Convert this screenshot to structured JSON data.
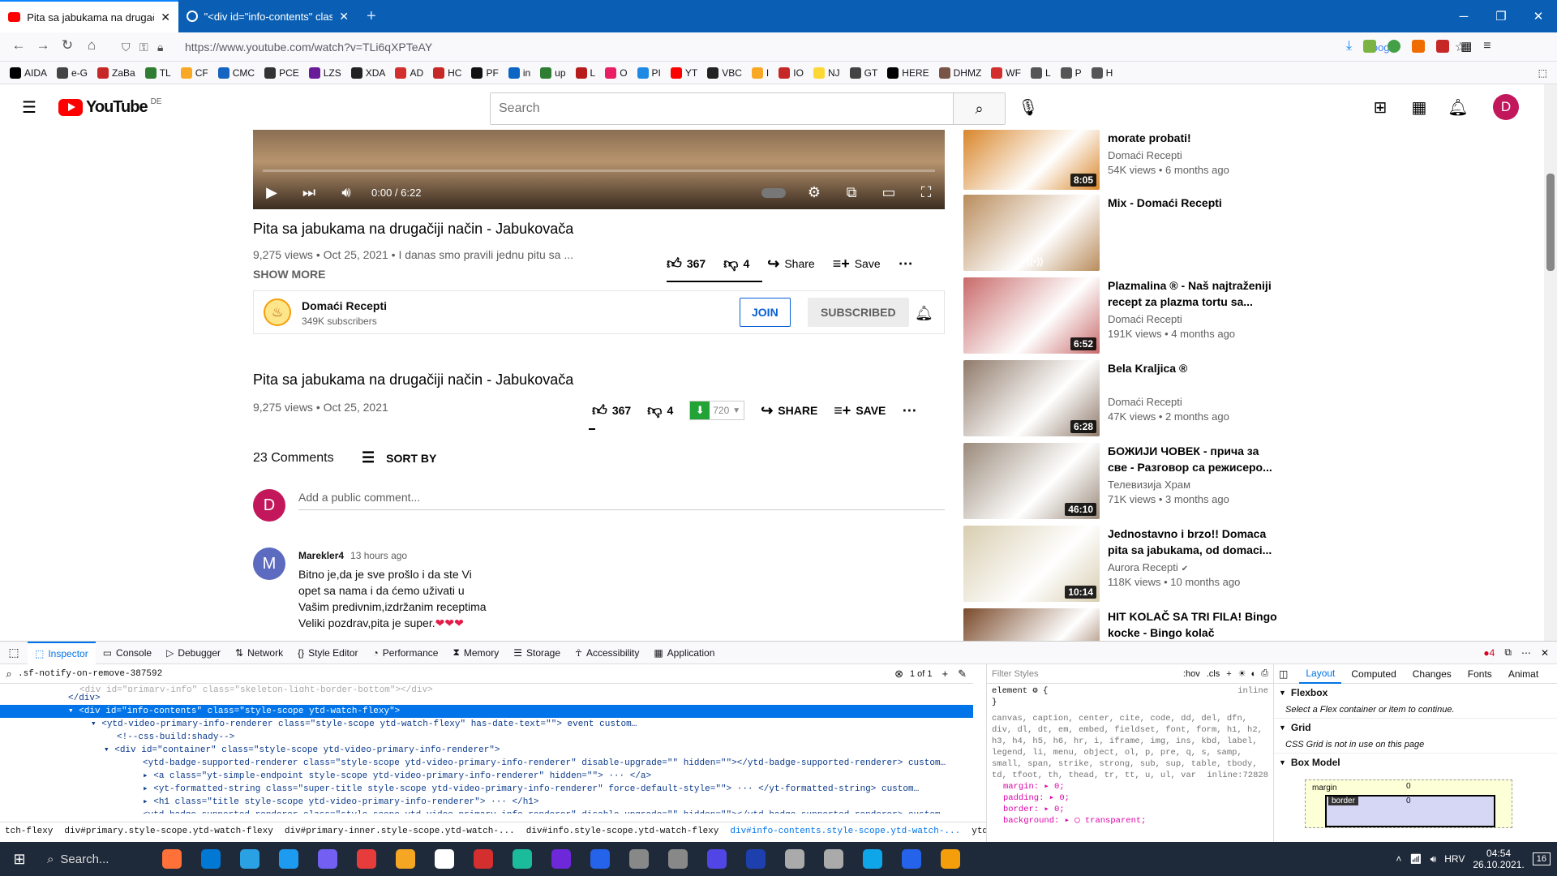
{
  "browser": {
    "tabs": [
      {
        "title": "Pita sa jabukama na drugačiji na",
        "active": true
      },
      {
        "title": "\"<div id=\"info-contents\" class=",
        "active": false
      }
    ],
    "new_tab": "+",
    "window_controls": {
      "minimize": "─",
      "restore": "❐",
      "close": "✕"
    },
    "url": "https://www.youtube.com/watch?v=TLi6qXPTeAY",
    "google_label": "Google",
    "bookmarks": [
      "AIDA",
      "e-G",
      "ZaBa",
      "TL",
      "CF",
      "CMC",
      "PCE",
      "LZS",
      "XDA",
      "AD",
      "HC",
      "PF",
      "in",
      "up",
      "L",
      "O",
      "PI",
      "YT",
      "VBC",
      "I",
      "IO",
      "NJ",
      "GT",
      "HERE",
      "DHMZ",
      "WF",
      "L",
      "P",
      "H"
    ],
    "bookmark_colors": [
      "#000",
      "#444",
      "#c62828",
      "#2e7d32",
      "#f9a825",
      "#1565c0",
      "#333",
      "#6a1b9a",
      "#222",
      "#d32f2f",
      "#c62828",
      "#111",
      "#0a66c2",
      "#2e7d32",
      "#b71c1c",
      "#e91e63",
      "#1e88e5",
      "#f00",
      "#222",
      "#f9a825",
      "#c62828",
      "#fdd835",
      "#444",
      "#000",
      "#795548",
      "#d32f2f",
      "#555",
      "#555",
      "#555"
    ]
  },
  "youtube": {
    "logo_text": "YouTube",
    "country": "DE",
    "search_placeholder": "Search",
    "avatar_letter": "D",
    "player": {
      "time": "0:00 / 6:22"
    },
    "video1": {
      "title": "Pita sa jabukama na drugačiji način - Jabukovača",
      "meta": "9,275 views • Oct 25, 2021 • I danas smo pravili jednu pitu sa ...",
      "show_more": "SHOW MORE",
      "likes": "367",
      "dislikes": "4",
      "share": "Share",
      "save": "Save"
    },
    "channel": {
      "name": "Domaći Recepti",
      "subscribers": "349K subscribers",
      "join": "JOIN",
      "subscribed": "SUBSCRIBED"
    },
    "video2": {
      "title": "Pita sa jabukama na drugačiji način - Jabukovača",
      "meta": "9,275 views • Oct 25, 2021",
      "likes": "367",
      "dislikes": "4",
      "download_quality": "720",
      "share": "SHARE",
      "save": "SAVE"
    },
    "comments": {
      "count": "23 Comments",
      "sort": "SORT BY",
      "add_placeholder": "Add a public comment...",
      "user_letter": "D",
      "items": [
        {
          "author": "Marekler4",
          "time": "13 hours ago",
          "avatar": "M",
          "lines": [
            "Bitno je,da je sve prošlo i da ste Vi",
            "opet sa nama i da ćemo uživati u",
            "Vašim predivnim,izdržanim receptima",
            "Veliki pozdrav,pita je super."
          ],
          "hearts": "❤❤❤"
        }
      ]
    },
    "recommended": [
      {
        "title": "morate probati!",
        "channel": "Domaći Recepti",
        "stats": "54K views • 6 months ago",
        "duration": "8:05",
        "color": "#d9862b"
      },
      {
        "title": "Mix - Domaći Recepti",
        "channel": "",
        "stats": "",
        "duration": "((•))",
        "color": "#b98c5c"
      },
      {
        "title": "Plazmalina ® - Naš najtraženiji recept za plazma tortu sa...",
        "channel": "Domaći Recepti",
        "stats": "191K views • 4 months ago",
        "duration": "6:52",
        "color": "#c96a6a"
      },
      {
        "title": "Bela Kraljica ®",
        "channel": "Domaći Recepti",
        "stats": "47K views • 2 months ago",
        "duration": "6:28",
        "color": "#8f7a6a"
      },
      {
        "title": "БОЖИЈИ ЧОВЕК - прича за све - Разговор са режисеро...",
        "channel": "Телевизија Храм",
        "stats": "71K views • 3 months ago",
        "duration": "46:10",
        "color": "#9a8a7a"
      },
      {
        "title": "Jednostavno i brzo!! Domaca pita sa jabukama, od domaci...",
        "channel": "Aurora Recepti",
        "stats": "118K views • 10 months ago",
        "duration": "10:14",
        "color": "#d8cdb0",
        "verified": "✔"
      },
      {
        "title": "HIT KOLAČ SA TRI FILA! Bingo kocke - Bingo kolač",
        "channel": "",
        "stats": "",
        "duration": "",
        "color": "#7a4a2a"
      }
    ]
  },
  "devtools": {
    "tabs": [
      "Inspector",
      "Console",
      "Debugger",
      "Network",
      "Style Editor",
      "Performance",
      "Memory",
      "Storage",
      "Accessibility",
      "Application"
    ],
    "error_count": "4",
    "search_value": ".sf-notify-on-remove-387592",
    "search_count": "1 of 1",
    "filter_placeholder": "Filter Styles",
    "hov": ":hov",
    "cls": ".cls",
    "right_tabs": [
      "Layout",
      "Computed",
      "Changes",
      "Fonts",
      "Animat"
    ],
    "html_lines": [
      "<div id=\"primary-info\" class=\"skeleton-light-border-bottom\"></div>",
      "</div>",
      "▾ <div id=\"info-contents\" class=\"style-scope ytd-watch-flexy\">",
      "▾ <ytd-video-primary-info-renderer class=\"style-scope ytd-watch-flexy\" has-date-text=\"\">  event  custom…",
      "<!--css-build:shady-->",
      "▾ <div id=\"container\" class=\"style-scope ytd-video-primary-info-renderer\">",
      "<ytd-badge-supported-renderer class=\"style-scope ytd-video-primary-info-renderer\" disable-upgrade=\"\" hidden=\"\"></ytd-badge-supported-renderer>  custom…",
      "▸ <a class=\"yt-simple-endpoint style-scope ytd-video-primary-info-renderer\" hidden=\"\"> ··· </a>",
      "▸ <yt-formatted-string class=\"super-title style-scope ytd-video-primary-info-renderer\" force-default-style=\"\"> ··· </yt-formatted-string>  custom…",
      "▸ <h1 class=\"title style-scope ytd-video-primary-info-renderer\"> ··· </h1>",
      "<ytd-badge-supported-renderer class=\"style-scope ytd-video-primary-info-renderer\" disable-upgrade=\"\" hidden=\"\"></ytd-badge-supported-renderer>  custom…"
    ],
    "breadcrumbs": [
      "tch-flexy",
      "div#primary.style-scope.ytd-watch-flexy",
      "div#primary-inner.style-scope.ytd-watch-...",
      "div#info.style-scope.ytd-watch-flexy",
      "div#info-contents.style-scope.ytd-watch-...",
      "ytd-video-primary-info-renderer.style-sc..."
    ],
    "rules": {
      "element_sel": "element",
      "inline": "inline",
      "selectors": "canvas, caption, center, cite, code, dd, del, dfn, div, dl, dt, em, embed, fieldset, font, form, h1, h2, h3, h4, h5, h6, hr, i, iframe, img, ins, kbd, label, legend, li, menu, object, ol, p, pre, q, s, samp, small, span, strike, strong, sub, sup, table, tbody, td, tfoot, th, thead, tr, tt, u, ul, var",
      "source": "inline:72828",
      "props": [
        "margin: ▸ 0;",
        "padding: ▸ 0;",
        "border: ▸ 0;",
        "background: ▸ ◯ transparent;"
      ]
    },
    "layout": {
      "flexbox": "Flexbox",
      "flexbox_msg": "Select a Flex container or item to continue.",
      "grid": "Grid",
      "grid_msg": "CSS Grid is not in use on this page",
      "boxmodel": "Box Model",
      "margin_label": "margin",
      "border_label": "border",
      "zero": "0"
    }
  },
  "taskbar": {
    "search": "Search...",
    "lang": "HRV",
    "time": "04:54",
    "date": "26.10.2021.",
    "notif": "16"
  }
}
